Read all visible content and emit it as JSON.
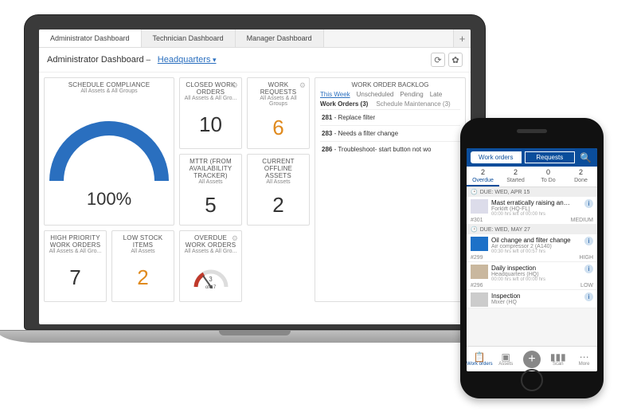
{
  "laptop": {
    "tabs": [
      "Administrator Dashboard",
      "Technician Dashboard",
      "Manager Dashboard"
    ],
    "title": "Administrator Dashboard",
    "location": "Headquarters",
    "cards": {
      "schedule": {
        "title": "SCHEDULE COMPLIANCE",
        "sub": "All Assets & All Groups",
        "gauge_pct": "100%"
      },
      "closed": {
        "title": "CLOSED WORK ORDERS",
        "sub": "All Assets & All Gro...",
        "value": "10"
      },
      "requests": {
        "title": "WORK REQUESTS",
        "sub": "All Assets & All Groups",
        "value": "6"
      },
      "mttr": {
        "title": "MTTR (FROM AVAILABILITY TRACKER)",
        "sub": "All Assets",
        "value": "5"
      },
      "offline": {
        "title": "CURRENT OFFLINE ASSETS",
        "sub": "All Assets",
        "value": "2"
      },
      "highprio": {
        "title": "HIGH PRIORITY WORK ORDERS",
        "sub": "All Assets & All Gro...",
        "value": "7"
      },
      "lowstock": {
        "title": "LOW STOCK ITEMS",
        "sub": "All Assets",
        "value": "2"
      },
      "overdue": {
        "title": "OVERDUE WORK ORDERS",
        "sub": "All Assets & All Gro...",
        "mini": "3",
        "mini_total": "of 17"
      }
    },
    "backlog": {
      "title": "WORK ORDER BACKLOG",
      "tabs": [
        "This Week",
        "Unscheduled",
        "Pending",
        "Late"
      ],
      "subtabs": [
        "Work Orders (3)",
        "Schedule Maintenance (3)"
      ],
      "rows": [
        {
          "id": "281",
          "text": "Replace filter"
        },
        {
          "id": "283",
          "text": "Needs a filter change"
        },
        {
          "id": "286",
          "text": "Troubleshoot- start button not wo"
        }
      ]
    }
  },
  "phone": {
    "segmented": [
      "Work orders",
      "Requests"
    ],
    "status": [
      {
        "count": "2",
        "label": "Overdue"
      },
      {
        "count": "2",
        "label": "Started"
      },
      {
        "count": "0",
        "label": "To Do"
      },
      {
        "count": "2",
        "label": "Done"
      }
    ],
    "groups": [
      {
        "due": "DUE: WED, APR 15",
        "items": [
          {
            "title": "Mast erratically raising an…",
            "asset": "Forklift (HQ-FL)",
            "time": "00:00 hrs left of 00:00 hrs",
            "num": "#301",
            "prio": "MEDIUM",
            "thumb": "fork"
          }
        ]
      },
      {
        "due": "DUE: WED, MAY 27",
        "items": [
          {
            "title": "Oil change and filter change",
            "asset": "Air compressor 2 (A140)",
            "time": "00:30 hrs left of 00:57 hrs",
            "num": "#299",
            "prio": "HIGH",
            "thumb": "blue"
          },
          {
            "title": "Daily inspection",
            "asset": "Headquarters (HQ)",
            "time": "00:00 hrs left of 00:00 hrs",
            "num": "#296",
            "prio": "LOW",
            "thumb": "bld"
          },
          {
            "title": "Inspection",
            "asset": "Mixer (HQ",
            "time": "",
            "num": "",
            "prio": "",
            "thumb": "grey"
          }
        ]
      }
    ],
    "tabbar": [
      "Work orders",
      "Assets",
      "",
      "Scan",
      "More"
    ]
  }
}
